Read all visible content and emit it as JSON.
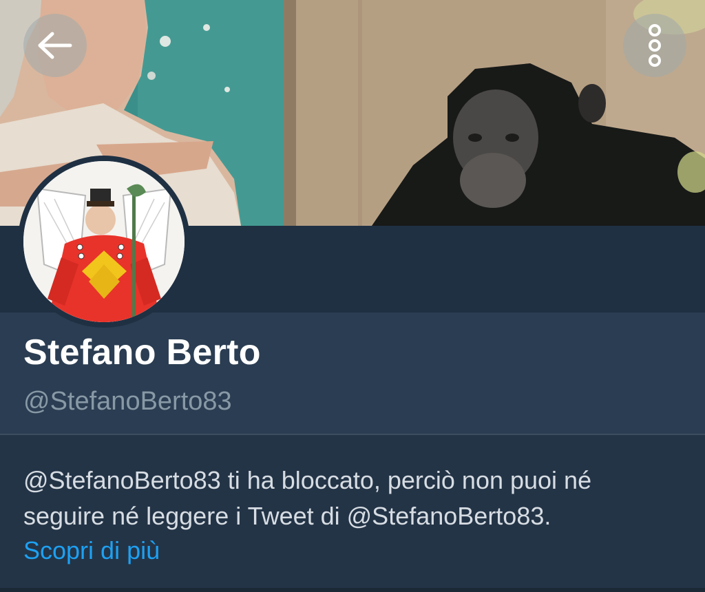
{
  "header": {
    "back_icon": "arrow-left-icon",
    "more_icon": "vertical-dots-icon"
  },
  "banner": {
    "description_icon": "banner-photo"
  },
  "profile": {
    "display_name": "Stefano Berto",
    "handle": "@StefanoBerto83"
  },
  "blocked_notice": {
    "message": "@StefanoBerto83 ti ha bloccato, perciò non puoi né seguire né leggere i Tweet di @StefanoBerto83.",
    "learn_more": "Scopri di più"
  },
  "colors": {
    "background": "#243447",
    "header_band": "#2b3d52",
    "name": "#ffffff",
    "handle": "#8899a6",
    "link": "#1da1f2"
  }
}
